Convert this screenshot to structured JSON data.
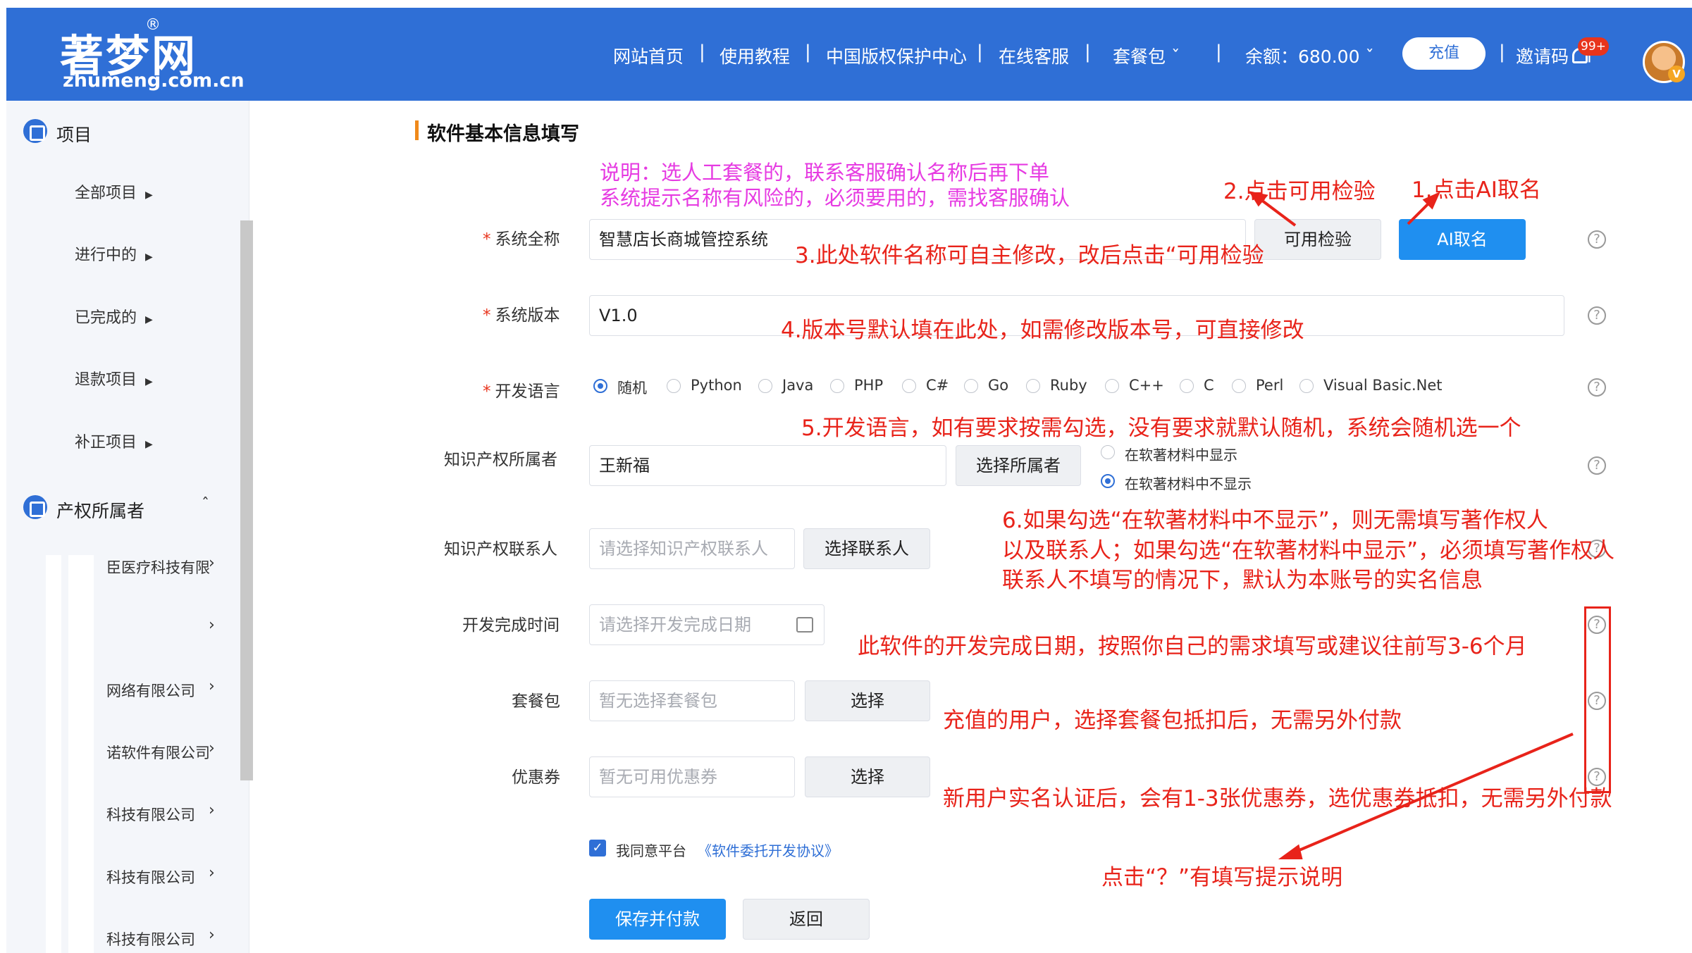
{
  "header": {
    "logo_main": "著梦网",
    "logo_reg": "®",
    "logo_sub": "zhumeng.com.cn",
    "nav": [
      "网站首页",
      "使用教程",
      "中国版权保护中心",
      "在线客服",
      "套餐包 ˇ",
      "余额：680.00 ˇ"
    ],
    "recharge": "充值",
    "invite": "邀请码",
    "badge": "99+",
    "avatar_badge": "V"
  },
  "sidebar": {
    "projects_title": "项目",
    "project_items": [
      "全部项目",
      "进行中的",
      "已完成的",
      "退款项目",
      "补正项目"
    ],
    "owners_title": "产权所属者",
    "owner_items": [
      "臣医疗科技有限",
      "",
      "网络有限公司",
      "诺软件有限公司",
      "科技有限公司",
      "科技有限公司",
      "科技有限公司"
    ]
  },
  "form": {
    "section_title": "软件基本信息填写",
    "note_line1": "说明：选人工套餐的，联系客服确认名称后再下单",
    "note_line2": "系统提示名称有风险的，必须要用的，需找客服确认",
    "name_label": "系统全称",
    "name_value": "智慧店长商城管控系统",
    "check_btn": "可用检验",
    "ai_btn": "AI取名",
    "version_label": "系统版本",
    "version_value": "V1.0",
    "lang_label": "开发语言",
    "languages": [
      "随机",
      "Python",
      "Java",
      "PHP",
      "C#",
      "Go",
      "Ruby",
      "C++",
      "C",
      "Perl",
      "Visual Basic.Net"
    ],
    "owner_label": "知识产权所属者",
    "owner_value": "王新福",
    "owner_btn": "选择所属者",
    "show_opt1": "在软著材料中显示",
    "show_opt2": "在软著材料中不显示",
    "contact_label": "知识产权联系人",
    "contact_placeholder": "请选择知识产权联系人",
    "contact_btn": "选择联系人",
    "date_label": "开发完成时间",
    "date_placeholder": "请选择开发完成日期",
    "package_label": "套餐包",
    "package_placeholder": "暂无选择套餐包",
    "package_btn": "选择",
    "coupon_label": "优惠券",
    "coupon_placeholder": "暂无可用优惠券",
    "coupon_btn": "选择",
    "agree_text": "我同意平台",
    "agree_link": "《软件委托开发协议》",
    "save_btn": "保存并付款",
    "back_btn": "返回",
    "help_mark": "?"
  },
  "annotations": {
    "a1": "1.点击AI取名",
    "a2": "2.点击可用检验",
    "a3": "3.此处软件名称可自主修改，改后点击“可用检验",
    "a4": "4.版本号默认填在此处，如需修改版本号，可直接修改",
    "a5": "5.开发语言，如有要求按需勾选，没有要求就默认随机，系统会随机选一个",
    "a6_1": "6.如果勾选“在软著材料中不显示”，则无需填写著作权人",
    "a6_2": "以及联系人；如果勾选“在软著材料中显示”，必须填写著作权人",
    "a6_3": "联系人不填写的情况下，默认为本账号的实名信息",
    "a7": "此软件的开发完成日期，按照你自己的需求填写或建议往前写3-6个月",
    "a8": "充值的用户，选择套餐包抵扣后，无需另外付款",
    "a9": "新用户实名认证后，会有1-3张优惠券，选优惠券抵扣，无需另外付款",
    "a10": "点击“？”有填写提示说明"
  },
  "colors": {
    "brand": "#2f6fd6",
    "annotation": "#e8231a",
    "note": "#e63be2",
    "accent": "#f08a1b"
  }
}
